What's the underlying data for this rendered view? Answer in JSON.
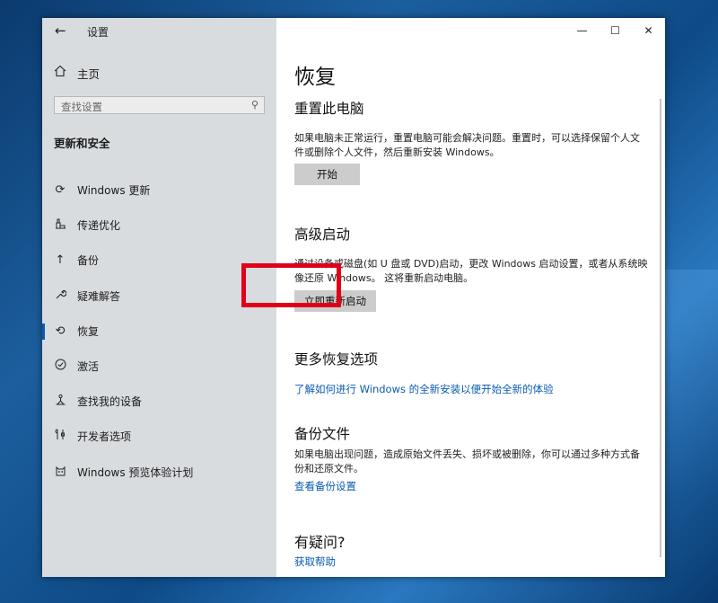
{
  "window": {
    "title": "设置",
    "controls": {
      "minimize": "—",
      "maximize": "☐",
      "close": "✕"
    }
  },
  "sidebar": {
    "home_label": "主页",
    "search_placeholder": "查找设置",
    "section_title": "更新和安全",
    "items": [
      {
        "label": "Windows 更新",
        "icon": "sync-icon"
      },
      {
        "label": "传递优化",
        "icon": "delivery-optimization-icon"
      },
      {
        "label": "备份",
        "icon": "backup-icon"
      },
      {
        "label": "疑难解答",
        "icon": "wrench-icon"
      },
      {
        "label": "恢复",
        "icon": "recovery-icon",
        "active": true
      },
      {
        "label": "激活",
        "icon": "check-circle-icon"
      },
      {
        "label": "查找我的设备",
        "icon": "find-device-icon"
      },
      {
        "label": "开发者选项",
        "icon": "developer-tools-icon"
      },
      {
        "label": "Windows 预览体验计划",
        "icon": "insider-cat-icon"
      }
    ]
  },
  "main": {
    "page_title": "恢复",
    "reset": {
      "heading": "重置此电脑",
      "description": "如果电脑未正常运行，重置电脑可能会解决问题。重置时，可以选择保留个人文件或删除个人文件，然后重新安装 Windows。",
      "button": "开始"
    },
    "advanced": {
      "heading": "高级启动",
      "description": "通过设备或磁盘(如 U 盘或 DVD)启动，更改 Windows 启动设置，或者从系统映像还原 Windows。 这将重新启动电脑。",
      "button": "立即重新启动"
    },
    "more": {
      "heading": "更多恢复选项",
      "link": "了解如何进行 Windows 的全新安装以便开始全新的体验"
    },
    "backup": {
      "heading": "备份文件",
      "description": "如果电脑出现问题，造成原始文件丢失、损坏或被删除，你可以通过多种方式备份和还原文件。",
      "link": "查看备份设置"
    },
    "help": {
      "heading": "有疑问?",
      "link": "获取帮助"
    }
  },
  "colors": {
    "accent": "#0a5bb0",
    "highlight": "#e1001a",
    "sidebar_bg": "#d9dcdf"
  }
}
